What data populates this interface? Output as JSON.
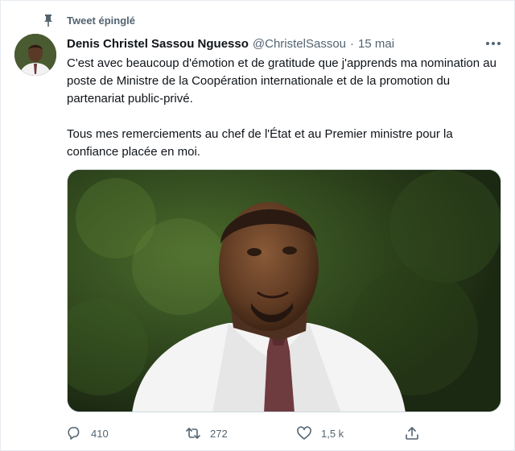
{
  "pinned": {
    "label": "Tweet épinglé"
  },
  "tweet": {
    "author_name": "Denis Christel Sassou Nguesso",
    "handle": "@ChristelSassou",
    "separator": "·",
    "date": "15 mai",
    "paragraphs": [
      "C'est avec beaucoup d'émotion et de gratitude que j'apprends ma nomination au poste de Ministre de la Coopération internationale et de la promotion du partenariat public-privé.",
      "Tous mes remerciements au chef de l'État et au Premier ministre pour la confiance placée en moi."
    ]
  },
  "actions": {
    "replies": "410",
    "retweets": "272",
    "likes": "1,5 k"
  },
  "icons": {
    "pin": "pin-icon",
    "more": "more-icon",
    "reply": "reply-icon",
    "retweet": "retweet-icon",
    "like": "heart-icon",
    "share": "share-icon"
  },
  "colors": {
    "text_primary": "#0f1419",
    "text_secondary": "#536471",
    "border": "#cfd9de"
  }
}
